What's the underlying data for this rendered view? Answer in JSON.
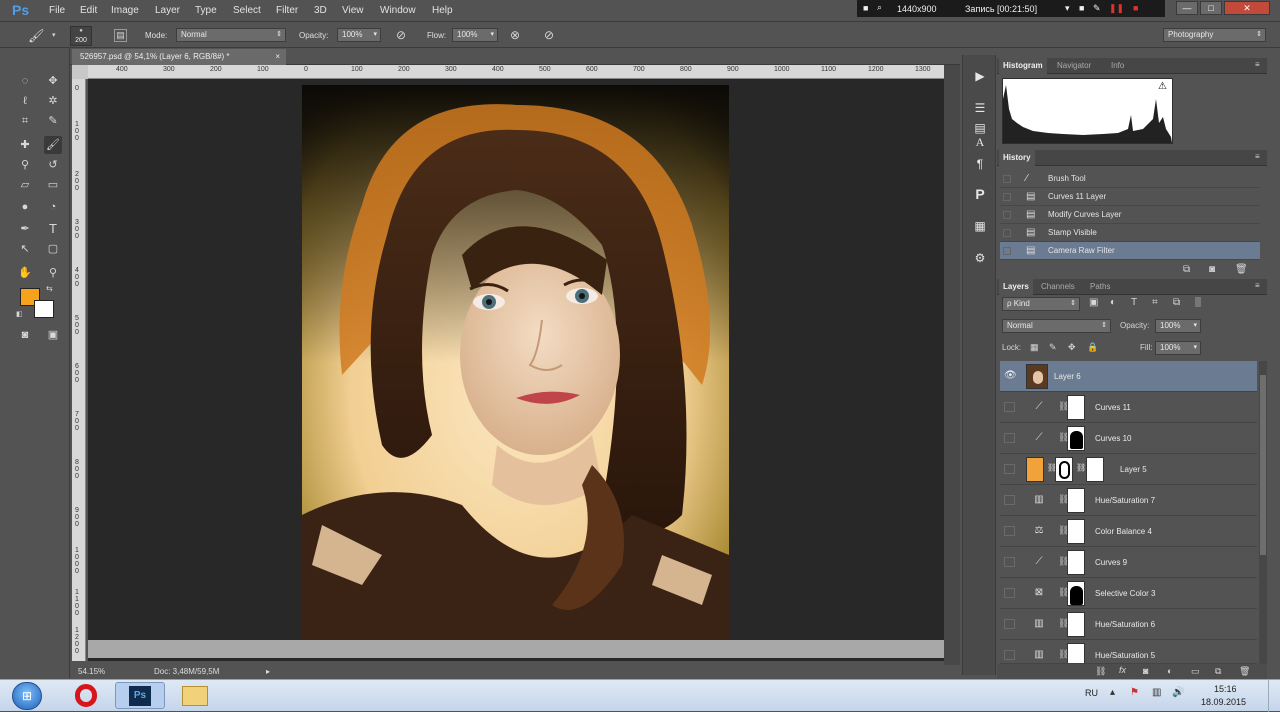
{
  "app": {
    "logo": "Ps"
  },
  "menu": [
    "File",
    "Edit",
    "Image",
    "Layer",
    "Type",
    "Select",
    "Filter",
    "3D",
    "View",
    "Window",
    "Help"
  ],
  "recorder": {
    "resolution": "1440x900",
    "status": "Запись [00:21:50]"
  },
  "window_controls": {
    "minimize": "—",
    "maximize": "□",
    "close": "✕"
  },
  "options": {
    "brush_size": "200",
    "mode_label": "Mode:",
    "mode_value": "Normal",
    "opacity_label": "Opacity:",
    "opacity_value": "100%",
    "flow_label": "Flow:",
    "flow_value": "100%",
    "workspace": "Photography"
  },
  "document": {
    "tab_title": "526957.psd @ 54,1% (Layer 6, RGB/8#) *",
    "tab_close": "×",
    "zoom": "54.15%",
    "doc_size": "Doc: 3,48M/59,5M"
  },
  "ruler_h": [
    "400",
    "300",
    "200",
    "100",
    "0",
    "100",
    "200",
    "300",
    "400",
    "500",
    "600",
    "700",
    "800",
    "900",
    "1000",
    "1100",
    "1200",
    "1300"
  ],
  "ruler_v": [
    "0",
    "1 0 0",
    "2 0 0",
    "3 0 0",
    "4 0 0",
    "5 0 0",
    "6 0 0",
    "7 0 0",
    "8 0 0",
    "9 0 0",
    "1 0 0 0",
    "1 1 0 0",
    "1 2 0 0",
    "1 3 0 0"
  ],
  "colors": {
    "foreground": "#f7a21c",
    "background": "#ffffff",
    "selection": "#6b7b91"
  },
  "histogram_panel": {
    "tabs": [
      "Histogram",
      "Navigator",
      "Info"
    ],
    "warning": "⚠"
  },
  "history_panel": {
    "tab": "History",
    "items": [
      "Brush Tool",
      "Curves 11 Layer",
      "Modify Curves Layer",
      "Stamp Visible",
      "Camera Raw Filter"
    ],
    "selected": "Camera Raw Filter"
  },
  "layers_panel": {
    "tabs": [
      "Layers",
      "Channels",
      "Paths"
    ],
    "kind_label": "ρ Kind",
    "blend_mode": "Normal",
    "opacity_label": "Opacity:",
    "opacity_value": "100%",
    "lock_label": "Lock:",
    "fill_label": "Fill:",
    "fill_value": "100%",
    "layers": [
      {
        "name": "Layer 6",
        "selected": true
      },
      {
        "name": "Curves 11"
      },
      {
        "name": "Curves 10"
      },
      {
        "name": "Layer 5"
      },
      {
        "name": "Hue/Saturation 7"
      },
      {
        "name": "Color Balance 4"
      },
      {
        "name": "Curves 9"
      },
      {
        "name": "Selective Color 3"
      },
      {
        "name": "Hue/Saturation 6"
      },
      {
        "name": "Hue/Saturation 5"
      }
    ]
  },
  "taskbar": {
    "lang": "RU",
    "time": "15:16",
    "date": "18.09.2015"
  }
}
